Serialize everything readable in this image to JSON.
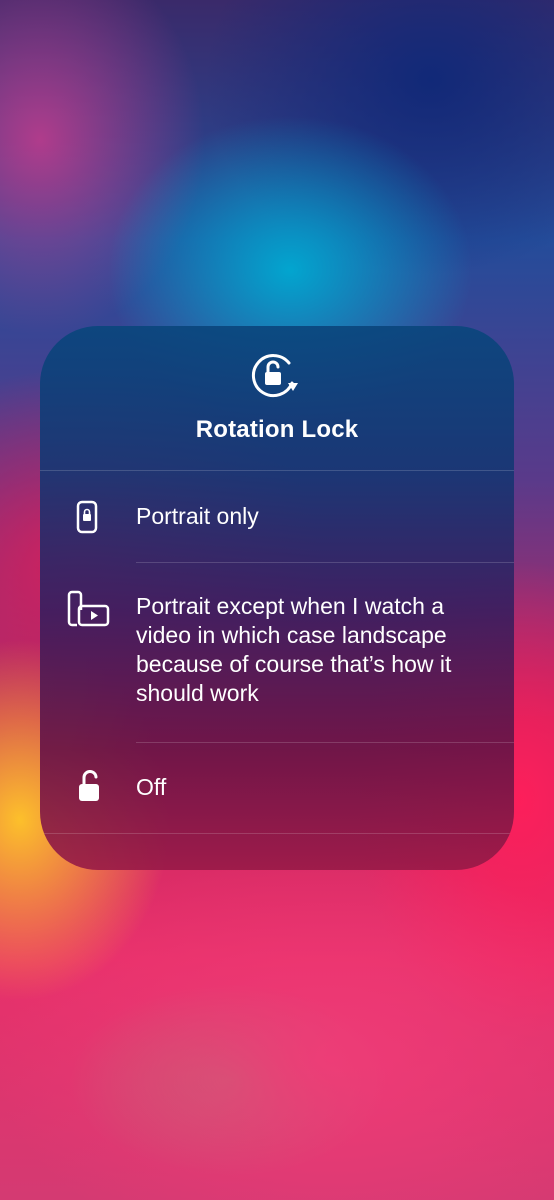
{
  "rotation_lock": {
    "icon": "rotation-lock-icon",
    "title": "Rotation Lock",
    "options": [
      {
        "icon": "portrait-phone-lock-icon",
        "label": "Portrait only"
      },
      {
        "icon": "portrait-landscape-video-icon",
        "label": "Portrait except when I watch a video in which case landscape because of course that’s how it should work"
      },
      {
        "icon": "unlocked-padlock-icon",
        "label": "Off"
      }
    ]
  }
}
